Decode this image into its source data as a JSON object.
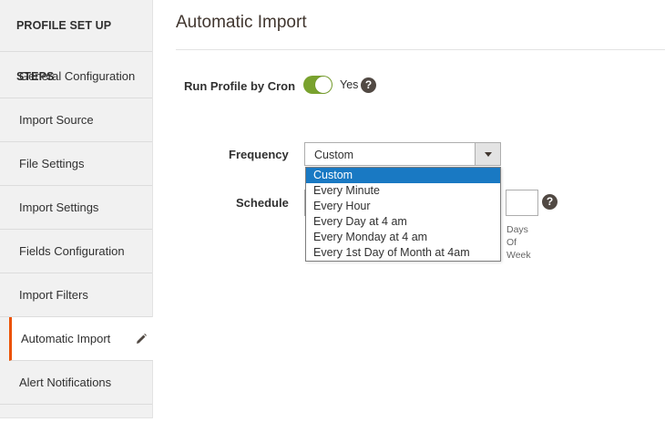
{
  "sidebar": {
    "title": "PROFILE SET UP STEPS",
    "items": [
      {
        "label": "General Configuration"
      },
      {
        "label": "Import Source"
      },
      {
        "label": "File Settings"
      },
      {
        "label": "Import Settings"
      },
      {
        "label": "Fields Configuration"
      },
      {
        "label": "Import Filters"
      },
      {
        "label": "Automatic Import",
        "active": true
      },
      {
        "label": "Alert Notifications"
      }
    ]
  },
  "main": {
    "title": "Automatic Import",
    "cron": {
      "label": "Run Profile by Cron",
      "value": "Yes",
      "enabled": true
    },
    "frequency": {
      "label": "Frequency",
      "selected": "Custom",
      "options": [
        "Custom",
        "Every Minute",
        "Every Hour",
        "Every Day at 4 am",
        "Every Monday at 4 am",
        "Every 1st Day of Month at 4am"
      ]
    },
    "schedule": {
      "label": "Schedule",
      "day_of_week_lines": [
        "Days",
        "Of",
        "Week"
      ]
    }
  },
  "colors": {
    "accent": "#eb5202",
    "toggle_on": "#79a22e",
    "selected_option": "#1979c3",
    "help_icon": "#514943"
  }
}
